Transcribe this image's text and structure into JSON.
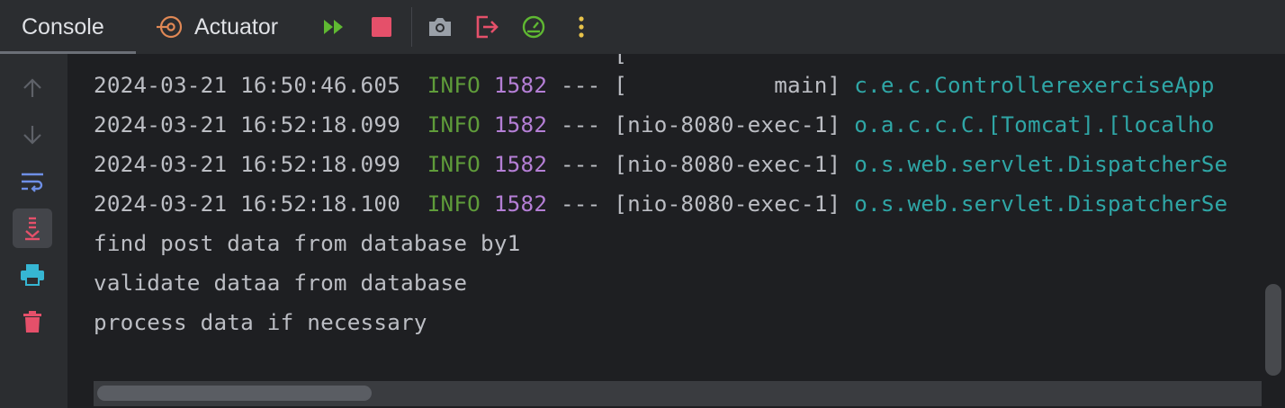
{
  "toolbar": {
    "tabs": [
      {
        "label": "Console"
      },
      {
        "label": "Actuator"
      }
    ],
    "icons": [
      "rerun-icon",
      "stop-icon",
      "camera-icon",
      "exit-icon",
      "dashboard-icon",
      "more-icon"
    ]
  },
  "gutter": {
    "icons": [
      "arrow-up-icon",
      "arrow-down-icon",
      "soft-wrap-icon",
      "scroll-to-end-icon",
      "print-icon",
      "trash-icon"
    ]
  },
  "console": {
    "log_lines": [
      {
        "timestamp": "2024-03-21 16:50:46.605",
        "level": "INFO",
        "pid": "1582",
        "sep": "---",
        "thread": "[           main]",
        "logger": "c.e.c.ControllerexerciseApp"
      },
      {
        "timestamp": "2024-03-21 16:52:18.099",
        "level": "INFO",
        "pid": "1582",
        "sep": "---",
        "thread": "[nio-8080-exec-1]",
        "logger": "o.a.c.c.C.[Tomcat].[localho"
      },
      {
        "timestamp": "2024-03-21 16:52:18.099",
        "level": "INFO",
        "pid": "1582",
        "sep": "---",
        "thread": "[nio-8080-exec-1]",
        "logger": "o.s.web.servlet.DispatcherSe"
      },
      {
        "timestamp": "2024-03-21 16:52:18.100",
        "level": "INFO",
        "pid": "1582",
        "sep": "---",
        "thread": "[nio-8080-exec-1]",
        "logger": "o.s.web.servlet.DispatcherSe"
      }
    ],
    "output_lines": [
      "find post data from database by1",
      "validate dataa from database",
      "process data if necessary"
    ]
  },
  "colors": {
    "info": "#5f9c3a",
    "pid": "#b57fd6",
    "logger": "#2fa6a6",
    "stop": "#e5506a",
    "rerun": "#5fb832"
  }
}
